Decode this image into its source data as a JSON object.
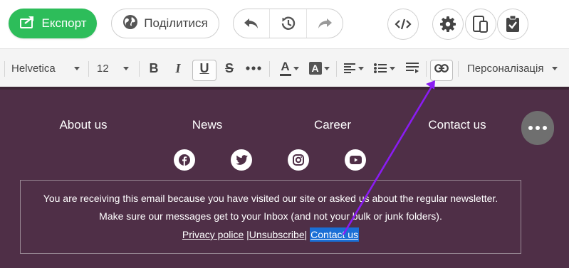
{
  "topbar": {
    "export_label": "Експорт",
    "share_label": "Поділитися",
    "icons": [
      "export-icon",
      "globe-icon",
      "undo-icon",
      "history-icon",
      "redo-icon",
      "code-icon",
      "gear-icon",
      "device-preview-icon",
      "clipboard-check-icon"
    ]
  },
  "toolbar": {
    "font_family": "Helvetica",
    "font_size": "12",
    "bold": "B",
    "italic": "I",
    "underline": "U",
    "strike": "S",
    "text_color": "A",
    "bg_color": "A",
    "personalization": "Персоналізація",
    "underline_active": true
  },
  "email": {
    "nav": [
      "About us",
      "News",
      "Career",
      "Contact us"
    ],
    "social_icons": [
      "facebook-icon",
      "twitter-icon",
      "instagram-icon",
      "youtube-icon"
    ],
    "notice_line1": "You are receiving this email because you have visited our site or asked us about the regular newsletter.",
    "notice_line2": "Make sure our messages get to your Inbox (and not your bulk or junk folders).",
    "link_privacy": "Privacy police",
    "sep1": " |",
    "link_unsubscribe": "Unsubscribe",
    "sep2": "| ",
    "link_contact": "Contact us"
  },
  "colors": {
    "export_green": "#2dbd5a",
    "email_bg": "#4f2f47",
    "selection": "#1a6fd6",
    "annotation_arrow": "#8a1cf2"
  }
}
